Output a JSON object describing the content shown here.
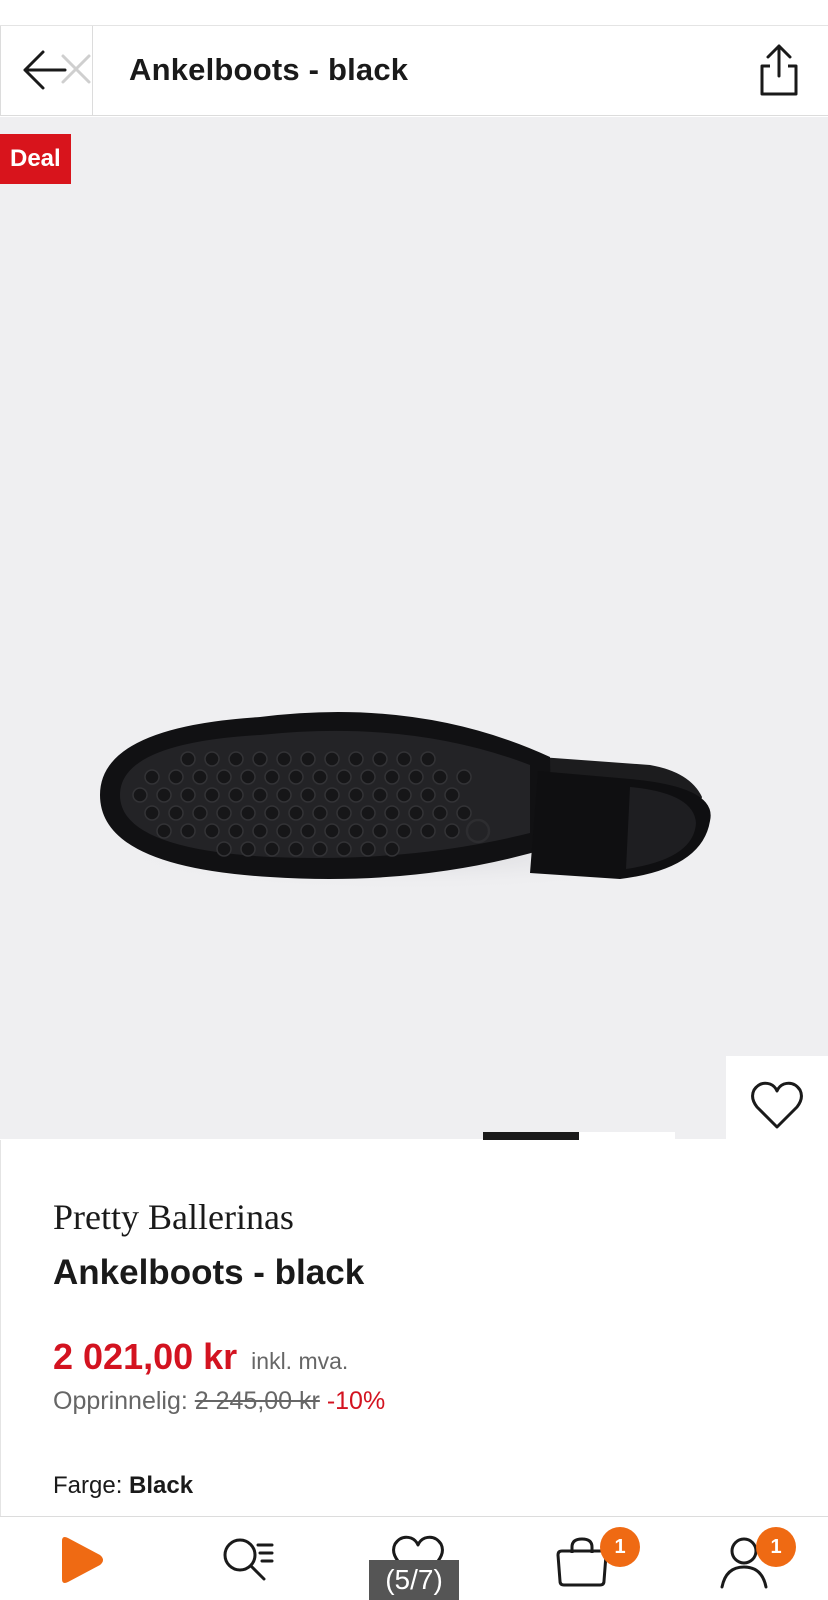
{
  "header": {
    "title": "Ankelboots - black",
    "back_icon": "arrow-left-icon",
    "share_icon": "share-icon"
  },
  "gallery": {
    "deal_label": "Deal",
    "image_name": "ankle-boot-sole-image",
    "current_index": 5,
    "total_images": 7,
    "counter_text": "(5/7)",
    "wishlist_icon": "heart-icon",
    "cart_icon": "shopping-bag-icon"
  },
  "product": {
    "brand": "Pretty Ballerinas",
    "name": "Ankelboots - black",
    "price": "2 021,00 kr",
    "vat_note": "inkl. mva.",
    "original_label": "Opprinnelig:",
    "original_price": "2 245,00 kr",
    "discount": "-10%",
    "color_label": "Farge:",
    "color_value": "Black"
  },
  "nav": {
    "items": [
      {
        "icon": "home-play-icon"
      },
      {
        "icon": "search-icon"
      },
      {
        "icon": "wishlist-heart-icon"
      },
      {
        "icon": "bag-icon",
        "badge": "1"
      },
      {
        "icon": "profile-icon",
        "badge": "1"
      }
    ]
  },
  "colors": {
    "accent_red": "#d31320",
    "deal_red": "#d8141c",
    "brand_orange": "#ef6a13",
    "dark": "#1a1a1a",
    "gallery_bg": "#efeff1"
  }
}
